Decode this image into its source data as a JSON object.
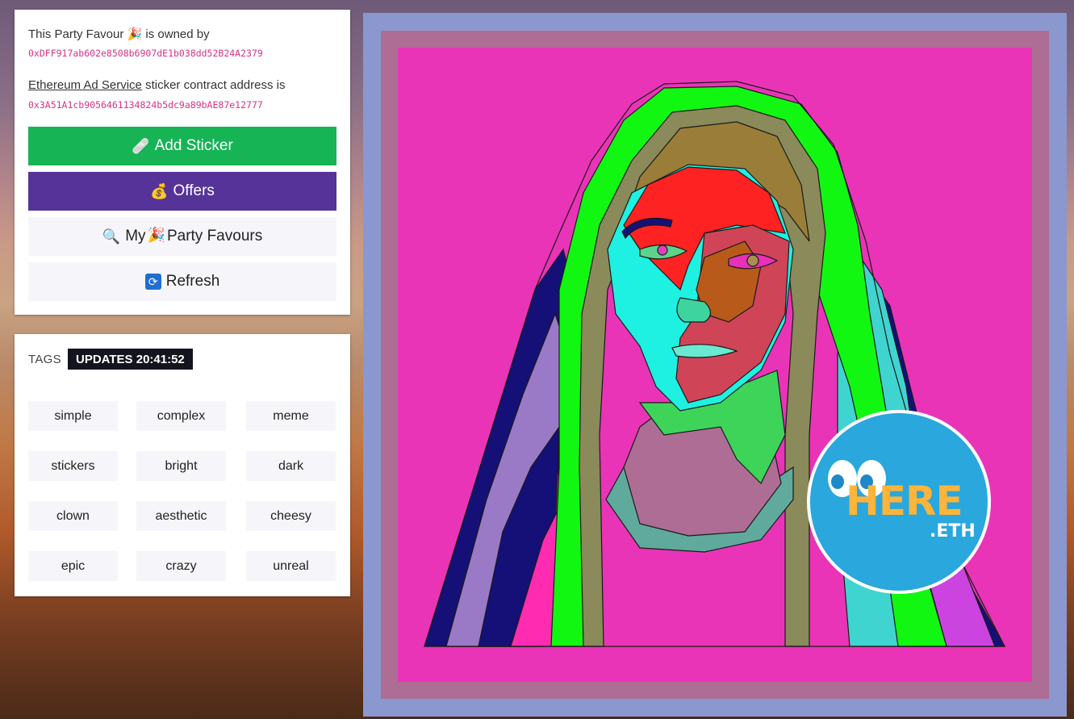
{
  "owner": {
    "prefix": "This Party Favour",
    "emoji": "🎉",
    "suffix": "is owned by",
    "address": "0xDFF917ab602e8508b6907dE1b038dd52B24A2379"
  },
  "contract": {
    "link_text": "Ethereum Ad Service",
    "suffix": " sticker contract address is",
    "address": "0x3A51A1cb9056461134824b5dc9a89bAE87e12777"
  },
  "buttons": {
    "add_sticker": {
      "icon": "🩹",
      "label": "Add Sticker",
      "color": "#16b455"
    },
    "offers": {
      "icon": "💰",
      "label": "Offers",
      "color": "#553399"
    },
    "my_favours": {
      "icon": "🔍",
      "label_a": "My",
      "icon2": "🎉",
      "label_b": "Party Favours"
    },
    "refresh": {
      "icon": "🔃",
      "label": "Refresh"
    }
  },
  "tags": {
    "label": "TAGS",
    "badge": "UPDATES 20:41:52",
    "items": [
      "simple",
      "complex",
      "meme",
      "stickers",
      "bright",
      "dark",
      "clown",
      "aesthetic",
      "cheesy",
      "epic",
      "crazy",
      "unreal"
    ]
  },
  "artwork": {
    "sticker_text": "HERE",
    "sticker_suffix": ".ETH",
    "colors": {
      "outer": "#8b97cf",
      "mid": "#ad6d94",
      "background": "#ea34b7",
      "sticker": "#2aa7dd"
    }
  }
}
